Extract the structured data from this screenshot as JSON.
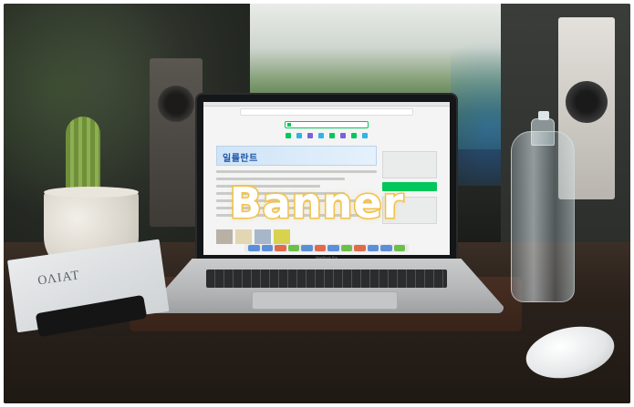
{
  "overlay": {
    "banner_label": "Banner",
    "stroke_color": "#f2c14a",
    "fill_color": "#ffffff"
  },
  "laptop": {
    "ad_text": "일룰란트",
    "bezel_label": "MacBook Pro",
    "brand_color": "#03c75a"
  },
  "newspaper": {
    "masthead": "ΟΛΙΑΤ"
  },
  "icons": {
    "search": "search-icon",
    "dock": "dock-icon"
  }
}
